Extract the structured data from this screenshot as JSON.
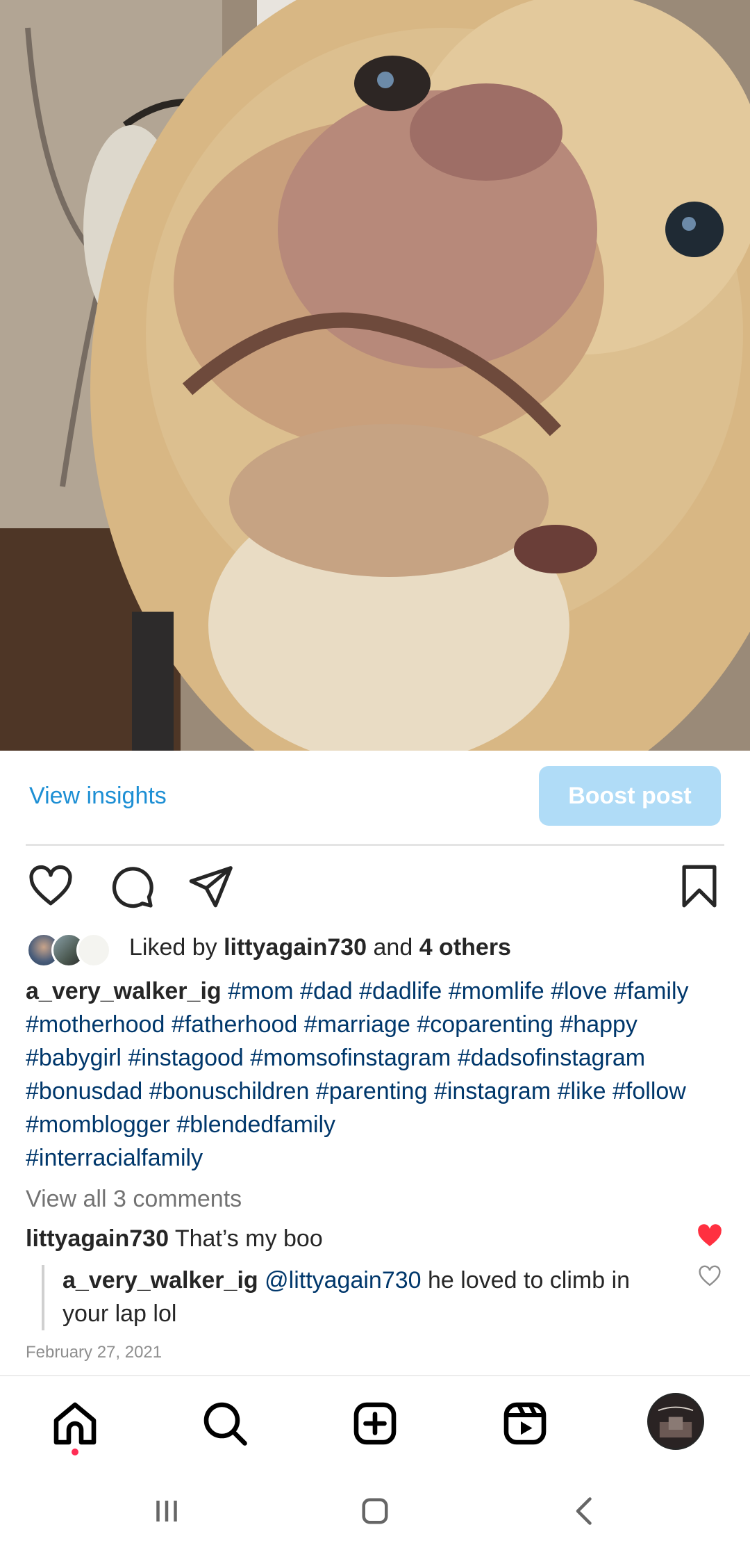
{
  "post": {
    "image_alt": "Close-up of a dog's face looking up at the camera"
  },
  "insights": {
    "view_insights_label": "View insights",
    "boost_post_label": "Boost post"
  },
  "actions": {
    "like_icon": "heart-icon",
    "comment_icon": "comment-icon",
    "share_icon": "send-icon",
    "save_icon": "bookmark-icon"
  },
  "likes": {
    "prefix": "Liked by ",
    "user": "littyagain730",
    "middle": " and ",
    "others": "4 others"
  },
  "caption": {
    "username": "a_very_walker_ig",
    "hashtags": [
      "#mom",
      "#dad",
      "#dadlife",
      "#momlife",
      "#love",
      "#family",
      "#motherhood",
      "#fatherhood",
      " #marriage",
      "#coparenting",
      "#happy",
      "#babygirl",
      "#instagood",
      "#momsofinstagram",
      "#dadsofinstagram",
      "#bonusdad",
      "#bonuschildren",
      "#parenting",
      "#instagram",
      "#like",
      "#follow",
      "#momblogger",
      "#blendedfamily",
      "#interracialfamily"
    ]
  },
  "comments": {
    "view_all_label": "View all 3 comments",
    "items": [
      {
        "user": "littyagain730",
        "text": "That’s my boo",
        "liked": true
      },
      {
        "user": "a_very_walker_ig",
        "mention": "@littyagain730",
        "text": " he loved to climb in your lap lol",
        "liked": false
      }
    ]
  },
  "date": "February 27, 2021",
  "colors": {
    "link_blue": "#1d8fd4",
    "hashtag_blue": "#00376b",
    "boost_bg": "#b0dcf7",
    "heart_red": "#ff3040",
    "muted_gray": "#737373"
  },
  "bottom_nav": {
    "items": [
      "home-icon",
      "search-icon",
      "create-icon",
      "reels-icon",
      "profile-avatar"
    ],
    "active": "home-icon"
  },
  "system_nav": {
    "items": [
      "recents-icon",
      "home-button-icon",
      "back-icon"
    ]
  }
}
